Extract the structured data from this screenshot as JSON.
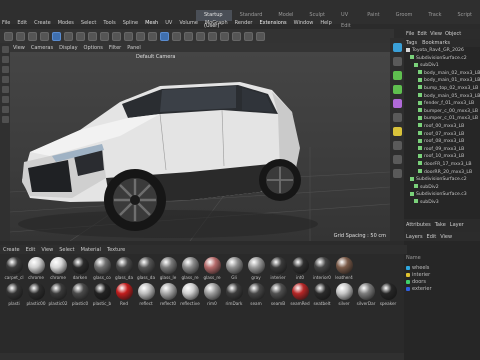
{
  "app_row": {
    "logo": ""
  },
  "layout_tabs": [
    "Startup (User)",
    "Standard",
    "Model",
    "Sculpt",
    "UV Edit",
    "Paint",
    "Groom",
    "Track",
    "Script"
  ],
  "main_menu": [
    "File",
    "Edit",
    "Create",
    "Modes",
    "Select",
    "Tools",
    "Spline",
    "Mesh",
    "UV",
    "Volume",
    "MoGraph",
    "Render",
    "Extensions",
    "Window",
    "Help"
  ],
  "viewport_menu": [
    "View",
    "Cameras",
    "Display",
    "Options",
    "Filter",
    "Panel"
  ],
  "viewport": {
    "camera_label": "Default Camera",
    "grid_spacing": "Grid Spacing : 50 cm"
  },
  "object_manager": {
    "tabs": [
      "File",
      "Edit",
      "View",
      "Object"
    ],
    "menu": [
      "Tags",
      "Bookmarks"
    ],
    "rows": [
      {
        "label": "Toyota_Rav4_GR_2026",
        "indent": 0
      },
      {
        "label": "SubdivisionSurface.c2",
        "indent": 1
      },
      {
        "label": "subDiv1",
        "indent": 2
      },
      {
        "label": "body_main_02_mxx3_LB",
        "indent": 3
      },
      {
        "label": "body_main_01_mxx3_LB",
        "indent": 3
      },
      {
        "label": "bump_top_02_mxx3_LB",
        "indent": 3
      },
      {
        "label": "body_main_05_mxx3_LB",
        "indent": 3
      },
      {
        "label": "fender_f_01_mxx3_LB",
        "indent": 3
      },
      {
        "label": "bumper_c_00_mxx3_LB",
        "indent": 3
      },
      {
        "label": "bumper_c_01_mxx3_LB",
        "indent": 3
      },
      {
        "label": "roof_00_mxx3_LB",
        "indent": 3
      },
      {
        "label": "roof_07_mxx3_LB",
        "indent": 3
      },
      {
        "label": "roof_08_mxx3_LB",
        "indent": 3
      },
      {
        "label": "roof_09_mxx3_LB",
        "indent": 3
      },
      {
        "label": "roof_10_mxx3_LB",
        "indent": 3
      },
      {
        "label": "doorFR_17_mxx3_LB",
        "indent": 3
      },
      {
        "label": "doorRR_20_mxx3_LB",
        "indent": 3
      },
      {
        "label": "SubdivisionSurface.c2",
        "indent": 1
      },
      {
        "label": "subDiv2",
        "indent": 2
      },
      {
        "label": "SubdivisionSurface.c3",
        "indent": 1
      },
      {
        "label": "subDiv3",
        "indent": 2
      }
    ]
  },
  "attribute_tabs": [
    "Attributes",
    "Take",
    "Layer"
  ],
  "layer_manager": {
    "tabs": [
      "Layers",
      "Edit",
      "View"
    ],
    "header": "Name",
    "layers": [
      {
        "name": "wheels",
        "color": "#2fa8e0"
      },
      {
        "name": "interier",
        "color": "#e0c22f"
      },
      {
        "name": "doors",
        "color": "#3fcf6a"
      },
      {
        "name": "exterier",
        "color": "#2f5fe0"
      }
    ]
  },
  "material_manager": {
    "tabs": [
      "Create",
      "Edit",
      "View",
      "Select",
      "Material",
      "Texture"
    ],
    "row1": [
      {
        "label": "carpet_cl",
        "color": "#3a3a3a"
      },
      {
        "label": "chrome",
        "color": "#cfcfcf"
      },
      {
        "label": "chrome",
        "color": "#d8d8d8"
      },
      {
        "label": "darken",
        "color": "#2a2a2a"
      },
      {
        "label": "glass_co",
        "color": "#6f6f6f"
      },
      {
        "label": "glass_da",
        "color": "#4b4b4b"
      },
      {
        "label": "glass_da",
        "color": "#555555"
      },
      {
        "label": "glass_le",
        "color": "#7a7a7a"
      },
      {
        "label": "glass_re",
        "color": "#8b8b8b"
      },
      {
        "label": "glass_re",
        "color": "#b56a6a"
      },
      {
        "label": "Gli",
        "color": "#909090"
      },
      {
        "label": "gray",
        "color": "#9a9a9a"
      },
      {
        "label": "interier",
        "color": "#3a3a3a"
      },
      {
        "label": "int0",
        "color": "#2e2e2e"
      },
      {
        "label": "interior0",
        "color": "#444444"
      },
      {
        "label": "leather4",
        "color": "#7a5a48"
      }
    ],
    "row2": [
      {
        "label": "plasti",
        "color": "#333333"
      },
      {
        "label": "plastic00",
        "color": "#2c2c2c"
      },
      {
        "label": "plastic02",
        "color": "#3b3b3b"
      },
      {
        "label": "plastic0",
        "color": "#4a4a4a"
      },
      {
        "label": "plastic_b",
        "color": "#222222"
      },
      {
        "label": "Red",
        "color": "#c21d1d"
      },
      {
        "label": "reflect",
        "color": "#bdbdbd"
      },
      {
        "label": "reflect0",
        "color": "#a8a8a8"
      },
      {
        "label": "reflective",
        "color": "#cfcfcf"
      },
      {
        "label": "rim0",
        "color": "#9d9d9d"
      },
      {
        "label": "rimDark",
        "color": "#3c3c3c"
      },
      {
        "label": "seam",
        "color": "#474747"
      },
      {
        "label": "seamB",
        "color": "#505050"
      },
      {
        "label": "seamRed",
        "color": "#b62626"
      },
      {
        "label": "seatbelt",
        "color": "#2a2a2a"
      },
      {
        "label": "silver",
        "color": "#c6c6c6"
      },
      {
        "label": "silverDar",
        "color": "#7c7c7c"
      },
      {
        "label": "speaker",
        "color": "#262626"
      }
    ]
  }
}
